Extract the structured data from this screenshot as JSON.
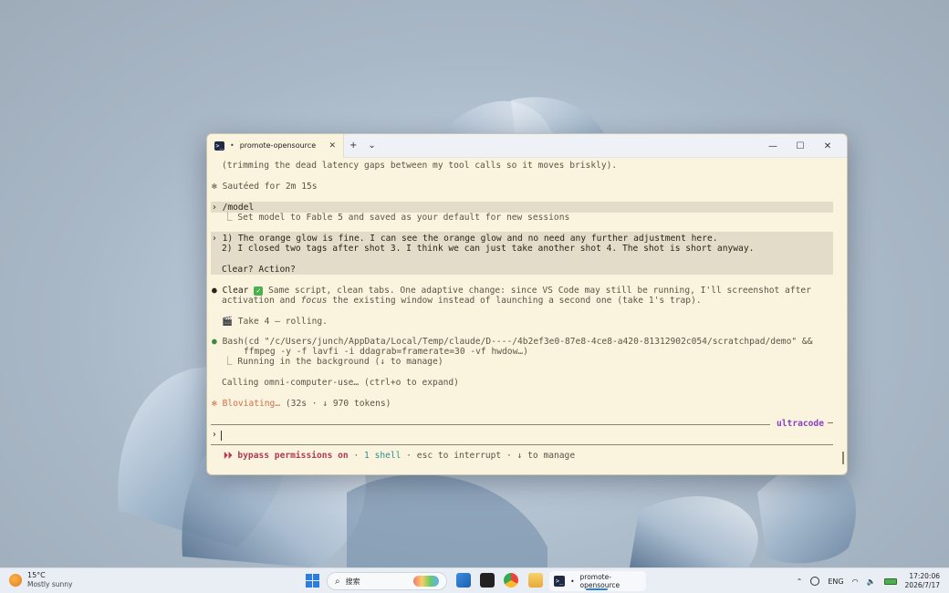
{
  "window": {
    "tab_title": "promote-opensource",
    "tab_dot": "•",
    "ps_glyph": ">_",
    "tab_close": "✕",
    "new_tab": "+",
    "tab_menu": "⌄",
    "minimize": "—",
    "maximize": "☐",
    "close": "✕"
  },
  "terminal": {
    "line_trim": "(trimming the dead latency gaps between my tool calls so it moves briskly).",
    "sauteed_star": "✻",
    "sauteed": "Sautéed for 2m 15s",
    "prompt_mark": "›",
    "model_cmd": "/model",
    "model_result_prefix": "⎿",
    "model_result": "Set model to Fable 5 and saved as your default for new sessions",
    "user_line1": "1) The orange glow is fine. I can see the orange glow and no need any further adjustment here.",
    "user_line2": "2) I closed two tags after shot 3. I think we can just take another shot 4. The shot is short anyway.",
    "user_line3": "Clear? Action?",
    "bullet": "●",
    "clear_word": "Clear",
    "check_glyph": "✓",
    "clear_rest": "Same script, clean tabs. One adaptive change: since VS Code may still be running, I'll screenshot after",
    "clear_line2_a": "activation and ",
    "clear_line2_em": "focus",
    "clear_line2_b": " the existing window instead of launching a second one (take 1's trap).",
    "take4_icon": "🎬",
    "take4": "Take 4 — rolling.",
    "bash_line1": "Bash(cd \"/c/Users/junch/AppData/Local/Temp/claude/D----/4b2ef3e0-87e8-4ce8-a420-81312902c054/scratchpad/demo\" &&",
    "bash_line2": "ffmpeg -y -f lavfi -i ddagrab=framerate=30 -vf hwdow…)",
    "bash_result": "Running in the background (↓ to manage)",
    "calling": "Calling omni-computer-use… (ctrl+o to expand)",
    "bloviating": "Bloviating…",
    "bloviating_meta": "(32s · ↓ 970 tokens)",
    "brand": "ultracode",
    "brand_dash": "─",
    "input_prompt": "›",
    "status_arrows": "⏵⏵",
    "bypass": "bypass permissions on",
    "dot_sep": "·",
    "shell": "1 shell",
    "esc": "esc to interrupt",
    "manage": "↓ to manage"
  },
  "taskbar": {
    "temperature": "15°C",
    "weather": "Mostly sunny",
    "search_glyph": "⌕",
    "search_placeholder": "搜索",
    "active_app": "promote-opensource",
    "active_dot": "•",
    "tray_chevron": "⌃",
    "lang": "ENG",
    "wifi": "◠",
    "volume": "🔈",
    "time": "17:20:06",
    "date": "2026/7/17"
  },
  "colors": {
    "terminal_bg": "#faf3dd",
    "accent_purple": "#8a3fc4",
    "bypass_red": "#b03a55",
    "shell_teal": "#2d8f8f",
    "bloviate_orange": "#cf6f4d"
  }
}
